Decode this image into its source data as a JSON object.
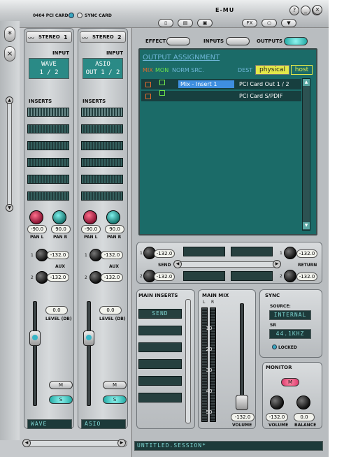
{
  "header": {
    "card_model": "0404 PCI CARD",
    "sync_card": "SYNC CARD",
    "brand": "E-MU",
    "toolbar": [
      "new-doc",
      "open",
      "save",
      "FX",
      "circle",
      "down"
    ],
    "window_controls": [
      "?",
      "_",
      "□",
      "×"
    ]
  },
  "left_tools": [
    "*",
    "×"
  ],
  "strips": [
    {
      "title": "STEREO",
      "number": "1",
      "input_label": "INPUT",
      "input_value_1": "WAVE",
      "input_value_2": "1 / 2",
      "inserts_label": "INSERTS",
      "pan_l": "-90.0",
      "pan_r": "90.0",
      "pan_l_label": "PAN L",
      "pan_r_label": "PAN R",
      "aux_label": "AUX",
      "aux1": "-132.0",
      "aux2": "-132.0",
      "aux_num1": "1",
      "aux_num2": "2",
      "level_value": "0.0",
      "level_label": "LEVEL (DB)",
      "mute": "M",
      "solo": "S",
      "name": "WAVE"
    },
    {
      "title": "STEREO",
      "number": "2",
      "input_label": "INPUT",
      "input_value_1": "ASIO",
      "input_value_2": "OUT 1 / 2",
      "inserts_label": "INSERTS",
      "pan_l": "-90.0",
      "pan_r": "90.0",
      "pan_l_label": "PAN L",
      "pan_r_label": "PAN R",
      "aux_label": "AUX",
      "aux1": "-132.0",
      "aux2": "-132.0",
      "aux_num1": "1",
      "aux_num2": "2",
      "level_value": "0.0",
      "level_label": "LEVEL (DB)",
      "mute": "M",
      "solo": "S",
      "name": "ASIO"
    }
  ],
  "routing": {
    "effect_label": "EFFECT",
    "inputs_label": "INPUTS",
    "outputs_label": "OUTPUTS",
    "title": "OUTPUT ASSIGNMENT",
    "col_mix": "MIX",
    "col_mon": "MON",
    "col_norm": "NORM SRC.",
    "col_dest": "DEST",
    "physical_tab": "physical",
    "host_tab": "host",
    "rows": [
      {
        "source": "Mix - Insert 1",
        "dest": "PCI Card Out 1 / 2"
      },
      {
        "source": "",
        "dest": "PCI Card S/PDIF"
      }
    ]
  },
  "send_return": {
    "send_label": "SEND",
    "return_label": "RETURN",
    "send1": "-132.0",
    "send2": "-132.0",
    "return1": "-132.0",
    "return2": "-132.0",
    "num1": "1",
    "num2": "2"
  },
  "main_inserts": {
    "label": "MAIN INSERTS",
    "first_slot": "SEND"
  },
  "main_mix": {
    "label": "MAIN MIX",
    "l": "L",
    "r": "R",
    "scale": [
      "10",
      "20",
      "30",
      "40",
      "50"
    ],
    "volume_value": "-132.0",
    "volume_label": "VOLUME"
  },
  "sync": {
    "label": "SYNC",
    "source_label": "SOURCE:",
    "source_value": "INTERNAL",
    "sr_label": "SR",
    "sr_value": "44.1KHZ",
    "locked": "LOCKED"
  },
  "monitor": {
    "label": "MONITOR",
    "mute": "M",
    "volume_value": "-132.0",
    "balance_value": "0.0",
    "volume_label": "VOLUME",
    "balance_label": "BALANCE"
  },
  "session": {
    "name": "UNTITLED.SESSION*"
  }
}
